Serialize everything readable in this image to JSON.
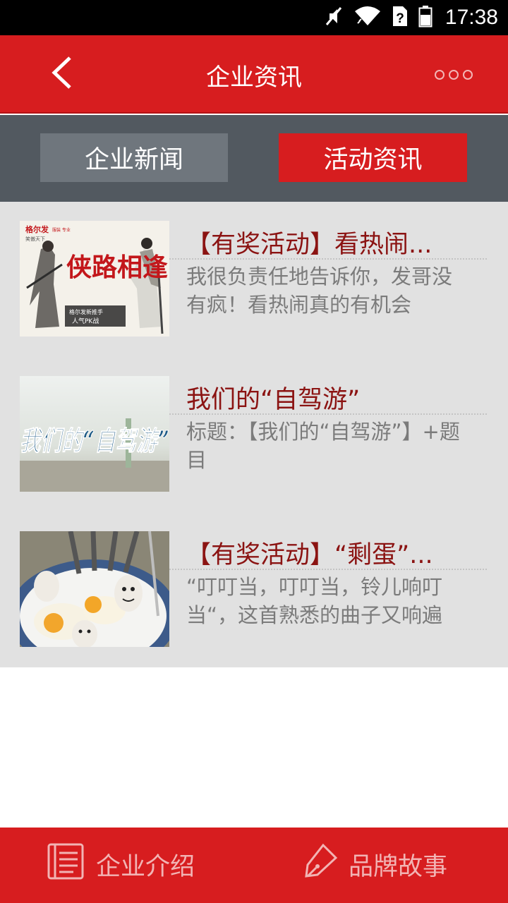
{
  "status_bar": {
    "time": "17:38",
    "icons": [
      "mute-icon",
      "wifi-icon",
      "sim-unknown-icon",
      "battery-icon"
    ]
  },
  "header": {
    "title": "企业资讯",
    "back_icon": "chevron-left-icon",
    "more_icon": "more-icon"
  },
  "tabs": [
    {
      "label": "企业新闻",
      "active": false
    },
    {
      "label": "活动资讯",
      "active": true
    }
  ],
  "articles": [
    {
      "title": "【有奖活动】看热闹...",
      "summary": "我很负责任地告诉你，发哥没有疯！看热闹真的有机会",
      "thumbnail": {
        "type": "illustration",
        "brand": "格尔发",
        "brand_sub": "服装 专业",
        "tagline": "笑傲天下",
        "headline": "侠路相逢",
        "caption_1": "格尔发新推手",
        "caption_2": "人气PK战"
      }
    },
    {
      "title": "我们的“自驾游”",
      "summary": "标题：【我们的“自驾游”】+题目",
      "thumbnail": {
        "type": "calligraphy",
        "text": "我们的“自驾游”"
      }
    },
    {
      "title": "【有奖活动】“剩蛋”...",
      "summary": "“叮叮当，叮叮当，铃儿响叮当“，这首熟悉的曲子又响遍",
      "thumbnail": {
        "type": "photo",
        "subject": "eggs-with-faces-and-forks"
      }
    }
  ],
  "bottom_nav": [
    {
      "label": "企业介绍",
      "icon": "document-icon"
    },
    {
      "label": "品牌故事",
      "icon": "pen-icon"
    }
  ],
  "colors": {
    "primary_red": "#d71d1f",
    "tab_bar_bg": "#525960",
    "tab_inactive_bg": "#6f767d",
    "list_bg": "#e1e1e1",
    "title_red": "#8b1312",
    "summary_gray": "#7b7b7b",
    "nav_text": "#f2b4b4"
  }
}
